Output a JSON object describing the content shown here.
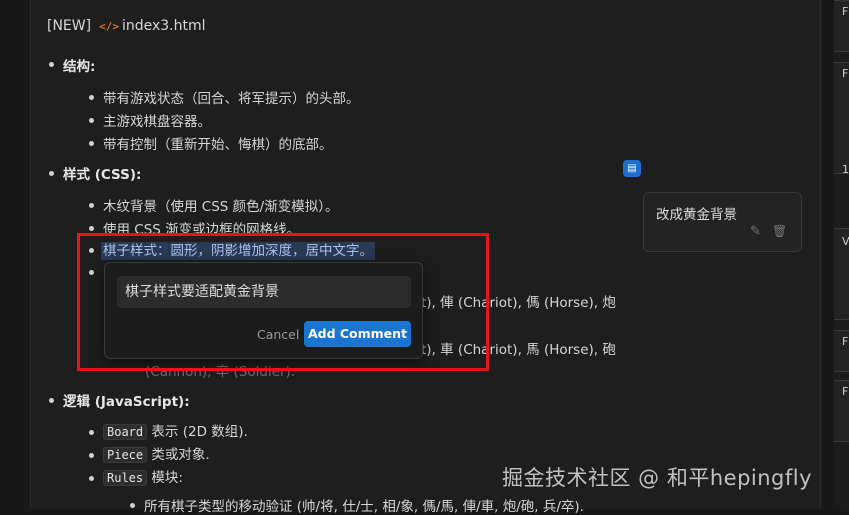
{
  "header": {
    "tag": "[NEW]",
    "icon": "code-icon",
    "filename": "index3.html"
  },
  "sections": {
    "structure": {
      "title": "结构",
      "items": [
        "带有游戏状态（回合、将军提示）的头部。",
        "主游戏棋盘容器。",
        "带有控制（重新开始、悔棋）的底部。"
      ]
    },
    "style": {
      "title": "样式 (CSS)",
      "items": [
        "木纹背景（使用 CSS 颜色/渐变模拟）。",
        "使用 CSS 渐变或边框的网格线。",
        "棋子样式：圆形，阴影增加深度，居中文字。"
      ],
      "hidden_line1_tail": "t), 俥 (Chariot), 傌 (Horse), 炮",
      "hidden_line2_tail": "t), 車 (Chariot), 馬 (Horse), 砲",
      "hidden_line3": "(Cannon), 卒 (Soldier)."
    },
    "logic": {
      "title": "逻辑 (JavaScript)",
      "items": [
        {
          "code": "Board",
          "text": "表示 (2D 数组)."
        },
        {
          "code": "Piece",
          "text": "类或对象."
        },
        {
          "code": "Rules",
          "text": "模块:"
        }
      ],
      "sub_item": "所有棋子类型的移动验证 (帅/将, 仕/士, 相/象, 傌/馬, 俥/車, 炮/砲, 兵/卒)."
    }
  },
  "saved_comment": {
    "text": "改成黄金背景"
  },
  "popup": {
    "input_value": "棋子样式要适配黄金背景",
    "cancel_label": "Cancel",
    "add_label": "Add Comment"
  },
  "right_cards": [
    "F",
    "F",
    "1",
    "V",
    "F",
    "F"
  ],
  "watermark": "掘金技术社区 @ 和平hepingfly",
  "colors": {
    "accent": "#1a75d2",
    "highlight_box": "#e5131b",
    "icon_orange": "#e0702e"
  }
}
